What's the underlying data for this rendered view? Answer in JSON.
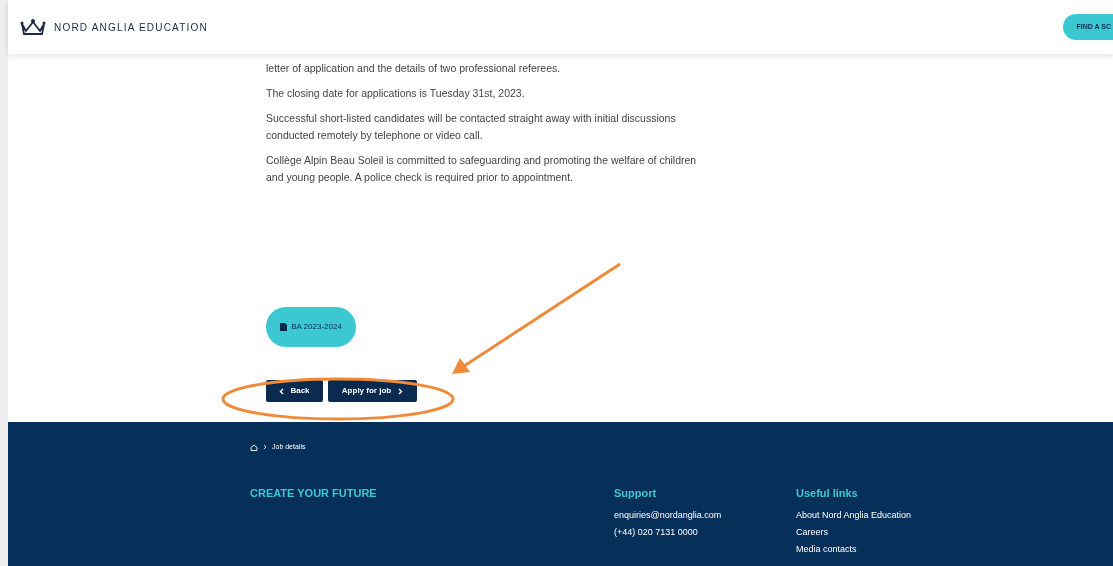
{
  "header": {
    "logo_text": "NORD ANGLIA EDUCATION",
    "cta": "FIND A SC"
  },
  "paragraphs": [
    "letter of application and the details of two professional referees.",
    "The closing date for applications is Tuesday 31st, 2023.",
    "Successful short-listed candidates will be contacted straight away with initial discussions conducted remotely by telephone or video call.",
    "Collège Alpin Beau Soleil is committed to safeguarding and promoting the welfare of children and young people. A police check is required prior to appointment."
  ],
  "attachment": {
    "label": "BA 2023-2024"
  },
  "buttons": {
    "back": "Back",
    "apply": "Apply for job"
  },
  "footer": {
    "breadcrumb": "Job details",
    "tagline": "CREATE YOUR FUTURE",
    "columns": [
      {
        "title": "Support",
        "links": [
          "enquiries@nordanglia.com",
          "(+44) 020 7131 0000"
        ]
      },
      {
        "title": "Useful links",
        "links": [
          "About Nord Anglia Education",
          "Careers",
          "Media contacts"
        ]
      }
    ]
  }
}
